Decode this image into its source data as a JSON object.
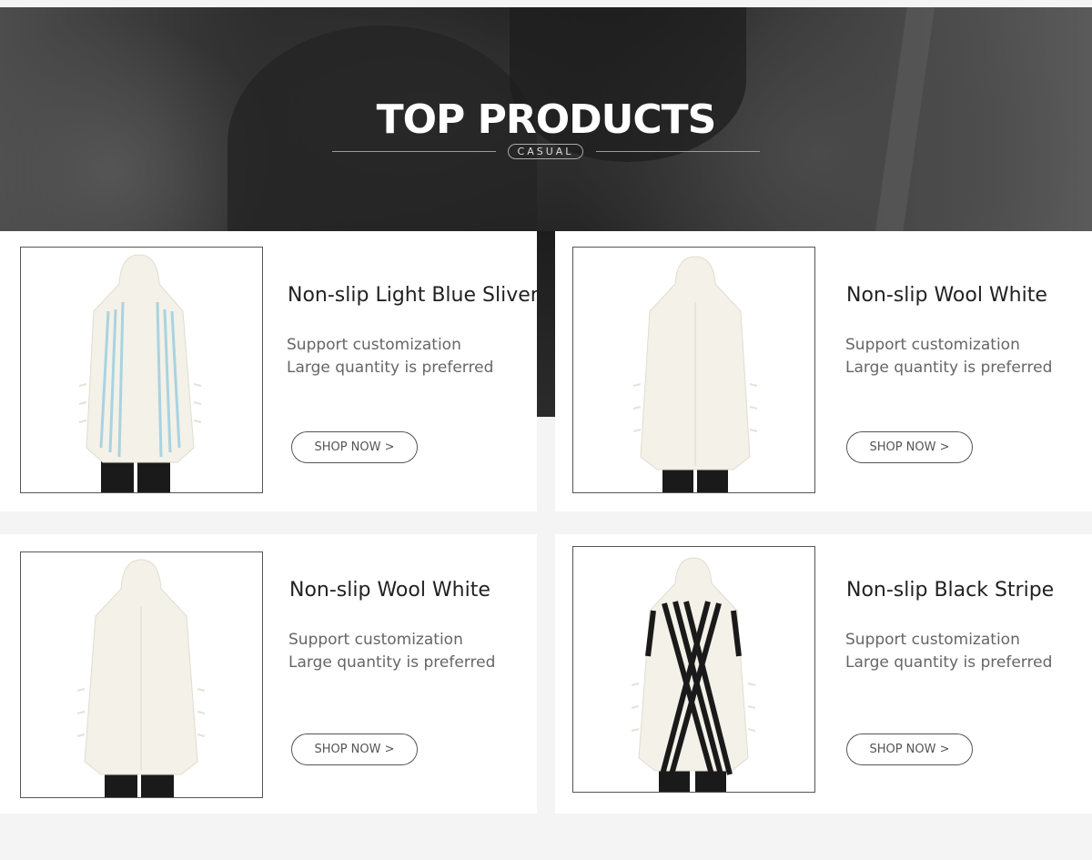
{
  "hero": {
    "title": "TOP PRODUCTS",
    "tag": "CASUAL"
  },
  "products": [
    {
      "name": "Non-slip Light Blue Sliver",
      "desc_line1": "Support customization",
      "desc_line2": "Large quantity is preferred",
      "button": "SHOP NOW >",
      "stripe_color": "#a9d3e0",
      "stripe_style": "light-blue-stripes"
    },
    {
      "name": "Non-slip Wool White",
      "desc_line1": "Support customization",
      "desc_line2": "Large quantity is preferred",
      "button": "SHOP NOW >",
      "stripe_color": "#f2f0e6",
      "stripe_style": "white"
    },
    {
      "name": "Non-slip Wool White",
      "desc_line1": "Support customization",
      "desc_line2": "Large quantity is preferred",
      "button": "SHOP NOW >",
      "stripe_color": "#f2f0e6",
      "stripe_style": "white"
    },
    {
      "name": "Non-slip Black Stripe",
      "desc_line1": "Support customization",
      "desc_line2": "Large quantity is preferred",
      "button": "SHOP NOW >",
      "stripe_color": "#1a1a1a",
      "stripe_style": "black-stripes"
    }
  ],
  "colors": {
    "page_bg": "#f4f4f4",
    "card_bg": "#ffffff",
    "text": "#222222",
    "muted": "#666666"
  }
}
